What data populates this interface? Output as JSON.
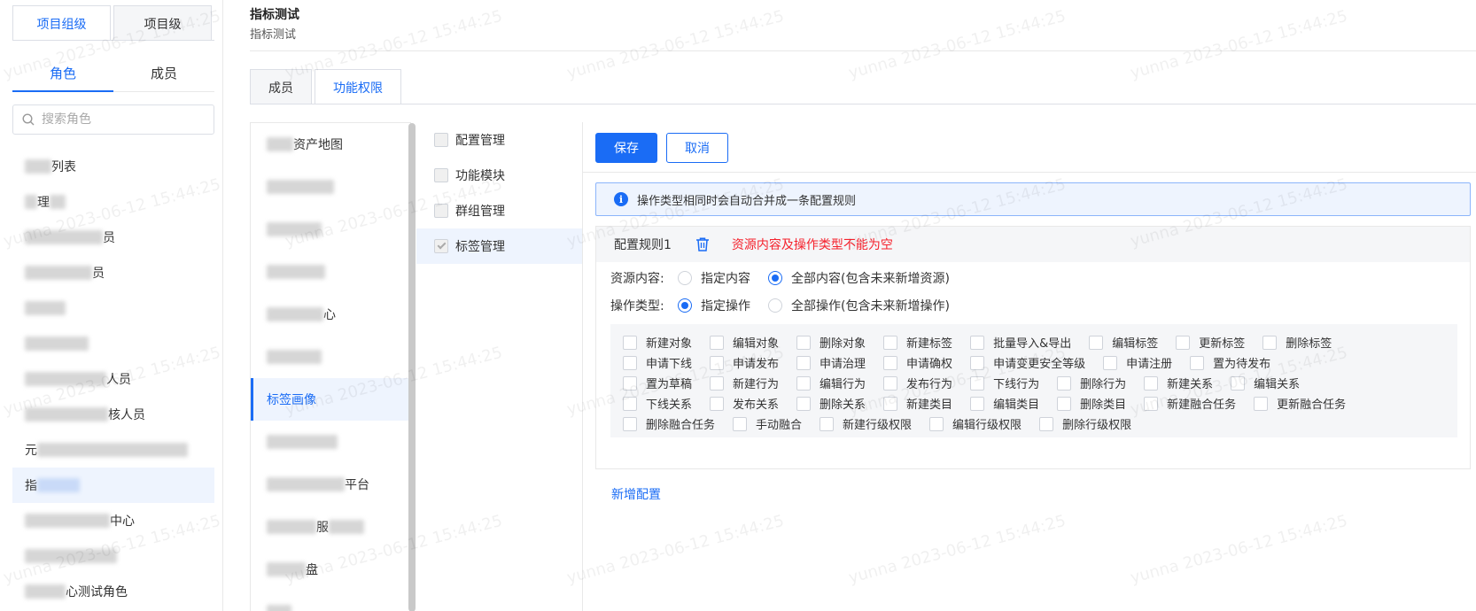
{
  "left": {
    "top_tabs": [
      "项目组级",
      "项目级"
    ],
    "sub_tabs": [
      "角色",
      "成员"
    ],
    "search_placeholder": "搜索角色",
    "roles": [
      {
        "prefix": "",
        "label": "列表"
      },
      {
        "prefix": "",
        "label": "理"
      },
      {
        "prefix": "",
        "label": "员"
      },
      {
        "prefix": "",
        "label": "员"
      },
      {
        "prefix": "",
        "label": ""
      },
      {
        "prefix": "",
        "label": ""
      },
      {
        "prefix": "",
        "label": "人员"
      },
      {
        "prefix": "",
        "label": "核人员"
      },
      {
        "prefix": "元",
        "label": ""
      },
      {
        "prefix": "指",
        "label": ""
      },
      {
        "prefix": "",
        "label": "中心"
      },
      {
        "prefix": "",
        "label": ""
      },
      {
        "prefix": "",
        "label": "心测试角色"
      }
    ]
  },
  "header": {
    "title": "指标测试",
    "subtitle": "指标测试"
  },
  "main_tabs": [
    "成员",
    "功能权限"
  ],
  "resources": [
    {
      "prefix": "",
      "label": "资产地图"
    },
    {
      "prefix": "",
      "label": ""
    },
    {
      "prefix": "",
      "label": ""
    },
    {
      "prefix": "",
      "label": ""
    },
    {
      "prefix": "",
      "label": "心"
    },
    {
      "prefix": "",
      "label": ""
    },
    {
      "prefix": "",
      "label": "标签画像"
    },
    {
      "prefix": "",
      "label": ""
    },
    {
      "prefix": "",
      "label": "平台"
    },
    {
      "prefix": "",
      "label": "服"
    },
    {
      "prefix": "",
      "label": "盘"
    },
    {
      "prefix": "",
      "label": ""
    }
  ],
  "modules": [
    "配置管理",
    "功能模块",
    "群组管理",
    "标签管理"
  ],
  "config": {
    "save_label": "保存",
    "cancel_label": "取消",
    "info_text": "操作类型相同时会自动合并成一条配置规则",
    "rule_title": "配置规则1",
    "rule_error": "资源内容及操作类型不能为空",
    "resource_content": {
      "label": "资源内容:",
      "options": [
        "指定内容",
        "全部内容(包含未来新增资源)"
      ],
      "selected": 1
    },
    "operation_type": {
      "label": "操作类型:",
      "options": [
        "指定操作",
        "全部操作(包含未来新增操作)"
      ],
      "selected": 0
    },
    "operations": [
      [
        "新建对象",
        "编辑对象",
        "删除对象",
        "新建标签",
        "批量导入&导出",
        "编辑标签",
        "更新标签",
        "删除标签"
      ],
      [
        "申请下线",
        "申请发布",
        "申请治理",
        "申请确权",
        "申请变更安全等级",
        "申请注册",
        "置为待发布"
      ],
      [
        "置为草稿",
        "新建行为",
        "编辑行为",
        "发布行为",
        "下线行为",
        "删除行为",
        "新建关系",
        "编辑关系"
      ],
      [
        "下线关系",
        "发布关系",
        "删除关系",
        "新建类目",
        "编辑类目",
        "删除类目",
        "新建融合任务",
        "更新融合任务"
      ],
      [
        "删除融合任务",
        "手动融合",
        "新建行级权限",
        "编辑行级权限",
        "删除行级权限"
      ]
    ],
    "add_config_label": "新增配置"
  },
  "watermark": "yunna 2023-06-12 15:44:25"
}
